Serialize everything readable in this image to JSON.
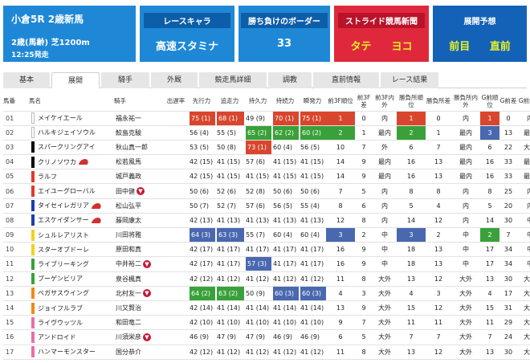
{
  "race_card": {
    "title": "小倉5R 2歳新馬",
    "conditions": "2歳(馬齢)  芝1200m",
    "start_time": "12:25発走"
  },
  "cards": [
    {
      "label": "レースキャラ",
      "value": "高速スタミナ",
      "color": "#1e88d6"
    },
    {
      "label": "勝ち負けのボーダー",
      "value": "33",
      "color": "#1e88d6"
    },
    {
      "label": "ストライド競馬新聞",
      "left": "タテ",
      "right": "ヨコ",
      "color": "#e0283c"
    },
    {
      "label": "展開予想",
      "left": "前目",
      "right": "直前",
      "color": "#1362b8"
    }
  ],
  "tabs": [
    "基本",
    "展開",
    "騎手",
    "外厩",
    "競走馬詳細",
    "調教",
    "直前情報",
    "レース結果"
  ],
  "active_tab": "展開",
  "headers": [
    "馬番",
    "馬名",
    "騎手",
    "出遅率",
    "先行力",
    "追走力",
    "持久力",
    "持続力",
    "瞬発力",
    "前3F順位",
    "前3F差",
    "前3F内外",
    "勝負所順位",
    "勝負所差",
    "勝負所内外",
    "G前順位",
    "G前差",
    "G前内外"
  ],
  "rows": [
    {
      "no": "01",
      "name": "メイケイエール",
      "jockey": "福永祐一",
      "deokure": "",
      "senko": "75 (1)",
      "tsuiso": "68 (1)",
      "jikyu": "49 (9)",
      "jizoku": "70 (1)",
      "shunpatsu": "75 (1)",
      "f3_rank": "1",
      "f3_diff": "0",
      "f3_pos": "内",
      "sh_rank": "1",
      "sh_diff": "0",
      "sh_pos": "内",
      "g_rank": "1",
      "g_diff": "0",
      "g_pos": "内",
      "waku": "#ffffff",
      "hl": {
        "senko": "red",
        "tsuiso": "red",
        "jizoku": "red",
        "shunpatsu": "red",
        "f3_rank": "red",
        "sh_rank": "red",
        "g_rank": "red"
      }
    },
    {
      "no": "02",
      "name": "ハルキジェイソウル",
      "jockey": "鮫島克駿",
      "deokure": "",
      "senko": "56 (4)",
      "tsuiso": "55 (5)",
      "jikyu": "65 (2)",
      "jizoku": "62 (2)",
      "shunpatsu": "60 (2)",
      "f3_rank": "2",
      "f3_diff": "1",
      "f3_pos": "最内",
      "sh_rank": "2",
      "sh_diff": "1",
      "sh_pos": "最内",
      "g_rank": "3",
      "g_diff": "13",
      "g_pos": "最内",
      "waku": "#ffffff",
      "hl": {
        "jikyu": "green",
        "jizoku": "green",
        "shunpatsu": "green",
        "f3_rank": "green",
        "sh_rank": "green",
        "g_rank": "blue"
      }
    },
    {
      "no": "03",
      "name": "スパークリングアイ",
      "jockey": "秋山真一郎",
      "deokure": "",
      "senko": "53 (5)",
      "tsuiso": "50 (8)",
      "jikyu": "73 (1)",
      "jizoku": "60 (4)",
      "shunpatsu": "56 (5)",
      "f3_rank": "10",
      "f3_diff": "7",
      "f3_pos": "外",
      "sh_rank": "6",
      "sh_diff": "7",
      "sh_pos": "最内",
      "g_rank": "6",
      "g_diff": "22",
      "g_pos": "大外",
      "waku": "#000000",
      "hl": {
        "jikyu": "red"
      }
    },
    {
      "no": "04",
      "name": "クリノソワカ",
      "jockey": "松若風馬",
      "deokure": "",
      "senko": "42 (15)",
      "tsuiso": "41 (15)",
      "jikyu": "57 (6)",
      "jizoku": "41 (15)",
      "shunpatsu": "41 (15)",
      "f3_rank": "14",
      "f3_diff": "9",
      "f3_pos": "最内",
      "sh_rank": "16",
      "sh_diff": "13",
      "sh_pos": "最内",
      "g_rank": "16",
      "g_diff": "33",
      "g_pos": "最内",
      "waku": "#000000",
      "hat": true,
      "hl": {}
    },
    {
      "no": "05",
      "name": "ラルフ",
      "jockey": "城戸義政",
      "deokure": "",
      "senko": "42 (15)",
      "tsuiso": "41 (15)",
      "jikyu": "41 (15)",
      "jizoku": "41 (15)",
      "shunpatsu": "41 (15)",
      "f3_rank": "14",
      "f3_diff": "9",
      "f3_pos": "最内",
      "sh_rank": "16",
      "sh_diff": "13",
      "sh_pos": "最内",
      "g_rank": "16",
      "g_diff": "33",
      "g_pos": "最内",
      "waku": "#e23a2a",
      "hl": {}
    },
    {
      "no": "06",
      "name": "エイユーグローバル",
      "jockey": "田中健",
      "deokure": "",
      "senko": "50 (6)",
      "tsuiso": "52 (6)",
      "jikyu": "52 (8)",
      "jizoku": "50 (6)",
      "shunpatsu": "50 (6)",
      "f3_rank": "7",
      "f3_diff": "5",
      "f3_pos": "内",
      "sh_rank": "8",
      "sh_diff": "8",
      "sh_pos": "内",
      "g_rank": "8",
      "g_diff": "25",
      "g_pos": "内",
      "waku": "#e23a2a",
      "jmark": true,
      "hl": {}
    },
    {
      "no": "07",
      "name": "タイセイレガリア",
      "jockey": "松山弘平",
      "deokure": "",
      "senko": "50 (7)",
      "tsuiso": "52 (7)",
      "jikyu": "57 (6)",
      "jizoku": "56 (5)",
      "shunpatsu": "55 (4)",
      "f3_rank": "8",
      "f3_diff": "6",
      "f3_pos": "内",
      "sh_rank": "5",
      "sh_diff": "4",
      "sh_pos": "内",
      "g_rank": "5",
      "g_diff": "20",
      "g_pos": "内",
      "waku": "#1a3eb0",
      "hat": true,
      "hl": {}
    },
    {
      "no": "08",
      "name": "エスケイダンサー",
      "jockey": "藤岡康太",
      "deokure": "",
      "senko": "42 (13)",
      "tsuiso": "41 (13)",
      "jikyu": "41 (13)",
      "jizoku": "41 (13)",
      "shunpatsu": "41 (13)",
      "f3_rank": "12",
      "f3_diff": "8",
      "f3_pos": "内",
      "sh_rank": "14",
      "sh_diff": "12",
      "sh_pos": "内",
      "g_rank": "14",
      "g_diff": "30",
      "g_pos": "中",
      "waku": "#1a3eb0",
      "hat": true,
      "hl": {}
    },
    {
      "no": "09",
      "name": "シュルレアリスト",
      "jockey": "川田将雅",
      "deokure": "",
      "senko": "64 (3)",
      "tsuiso": "63 (3)",
      "jikyu": "55 (7)",
      "jizoku": "60 (4)",
      "shunpatsu": "60 (4)",
      "f3_rank": "3",
      "f3_diff": "2",
      "f3_pos": "中",
      "sh_rank": "3",
      "sh_diff": "2",
      "sh_pos": "中",
      "g_rank": "2",
      "g_diff": "7",
      "g_pos": "中",
      "waku": "#f2d21a",
      "hl": {
        "senko": "blue",
        "tsuiso": "blue",
        "f3_rank": "blue",
        "sh_rank": "blue",
        "g_rank": "green"
      }
    },
    {
      "no": "10",
      "name": "スターオブドーレ",
      "jockey": "原田和真",
      "deokure": "",
      "senko": "42 (17)",
      "tsuiso": "41 (17)",
      "jikyu": "41 (17)",
      "jizoku": "41 (17)",
      "shunpatsu": "41 (17)",
      "f3_rank": "16",
      "f3_diff": "9",
      "f3_pos": "中",
      "sh_rank": "18",
      "sh_diff": "13",
      "sh_pos": "中",
      "g_rank": "17",
      "g_diff": "34",
      "g_pos": "中",
      "waku": "#f2d21a",
      "hl": {}
    },
    {
      "no": "11",
      "name": "ライブリーキング",
      "jockey": "中井裕二",
      "deokure": "",
      "senko": "42 (17)",
      "tsuiso": "41 (17)",
      "jikyu": "57 (3)",
      "jizoku": "41 (17)",
      "shunpatsu": "41 (17)",
      "f3_rank": "16",
      "f3_diff": "9",
      "f3_pos": "中",
      "sh_rank": "18",
      "sh_diff": "13",
      "sh_pos": "中",
      "g_rank": "17",
      "g_diff": "34",
      "g_pos": "中",
      "waku": "#3aa13a",
      "jmark": true,
      "hl": {
        "jikyu": "blue"
      }
    },
    {
      "no": "12",
      "name": "ブーゲンビリア",
      "jockey": "泉谷楓真",
      "deokure": "",
      "senko": "42 (12)",
      "tsuiso": "41 (12)",
      "jikyu": "41 (12)",
      "jizoku": "41 (12)",
      "shunpatsu": "41 (12)",
      "f3_rank": "11",
      "f3_diff": "8",
      "f3_pos": "大外",
      "sh_rank": "13",
      "sh_diff": "12",
      "sh_pos": "大外",
      "g_rank": "13",
      "g_diff": "30",
      "g_pos": "大外",
      "waku": "#3aa13a",
      "hl": {}
    },
    {
      "no": "13",
      "name": "ペガサスウイング",
      "jockey": "北村友一",
      "deokure": "",
      "senko": "64 (2)",
      "tsuiso": "63 (2)",
      "jikyu": "50 (9)",
      "jizoku": "60 (3)",
      "shunpatsu": "60 (3)",
      "f3_rank": "4",
      "f3_diff": "3",
      "f3_pos": "大外",
      "sh_rank": "4",
      "sh_diff": "3",
      "sh_pos": "大外",
      "g_rank": "4",
      "g_diff": "17",
      "g_pos": "大外",
      "waku": "#f08a1a",
      "jmark": true,
      "hl": {
        "senko": "green",
        "tsuiso": "green",
        "jizoku": "blue",
        "shunpatsu": "blue"
      }
    },
    {
      "no": "14",
      "name": "ジョイフルラブ",
      "jockey": "川又賢治",
      "deokure": "",
      "senko": "42 (14)",
      "tsuiso": "41 (14)",
      "jikyu": "41 (14)",
      "jizoku": "41 (14)",
      "shunpatsu": "41 (14)",
      "f3_rank": "13",
      "f3_diff": "9",
      "f3_pos": "大外",
      "sh_rank": "15",
      "sh_diff": "12",
      "sh_pos": "大外",
      "g_rank": "15",
      "g_diff": "31",
      "g_pos": "大外",
      "waku": "#f08a1a",
      "hl": {}
    },
    {
      "no": "15",
      "name": "ライヴウッツル",
      "jockey": "和田竜二",
      "deokure": "",
      "senko": "42 (10)",
      "tsuiso": "41 (10)",
      "jikyu": "41 (10)",
      "jizoku": "41 (10)",
      "shunpatsu": "41 (10)",
      "f3_rank": "9",
      "f3_diff": "7",
      "f3_pos": "大外",
      "sh_rank": "11",
      "sh_diff": "11",
      "sh_pos": "大外",
      "g_rank": "11",
      "g_diff": "29",
      "g_pos": "大外",
      "waku": "#e86fa8",
      "hl": {}
    },
    {
      "no": "16",
      "name": "アンドロイド",
      "jockey": "川須栄彦",
      "deokure": "",
      "senko": "46 (9)",
      "tsuiso": "47 (9)",
      "jikyu": "47 (9)",
      "jizoku": "46 (9)",
      "shunpatsu": "46 (9)",
      "f3_rank": "6",
      "f3_diff": "5",
      "f3_pos": "大外",
      "sh_rank": "7",
      "sh_diff": "7",
      "sh_pos": "大外",
      "g_rank": "7",
      "g_diff": "24",
      "g_pos": "大外",
      "waku": "#e86fa8",
      "jmark": true,
      "hl": {}
    },
    {
      "no": "17",
      "name": "ハンマーモンスター",
      "jockey": "国分恭介",
      "deokure": "",
      "senko": "42 (12)",
      "tsuiso": "41 (12)",
      "jikyu": "41 (12)",
      "jizoku": "41 (12)",
      "shunpatsu": "41 (12)",
      "f3_rank": "11",
      "f3_diff": "8",
      "f3_pos": "大外",
      "sh_rank": "13",
      "sh_diff": "12",
      "sh_pos": "大外",
      "g_rank": "13",
      "g_diff": "30",
      "g_pos": "大外",
      "waku": "#e86fa8",
      "hl": {}
    }
  ]
}
